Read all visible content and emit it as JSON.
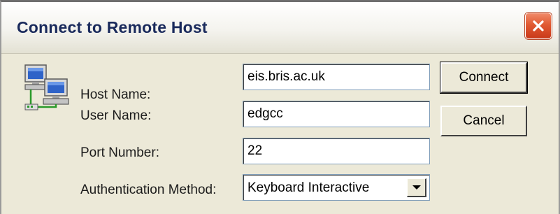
{
  "window": {
    "title": "Connect to Remote Host"
  },
  "icons": {
    "close": "close-icon",
    "computer": "networked-computers-icon",
    "dropdown": "chevron-down-icon"
  },
  "form": {
    "host_name": {
      "label": "Host Name:",
      "value": "eis.bris.ac.uk"
    },
    "user_name": {
      "label": "User Name:",
      "value": "edgcc"
    },
    "port_number": {
      "label": "Port Number:",
      "value": "22"
    },
    "auth_method": {
      "label": "Authentication Method:",
      "selected": "Keyboard Interactive"
    }
  },
  "buttons": {
    "connect": "Connect",
    "cancel": "Cancel"
  },
  "colors": {
    "title_text": "#1a2a5c",
    "close_button": "#e15a32",
    "dialog_background": "#ece9d8"
  }
}
